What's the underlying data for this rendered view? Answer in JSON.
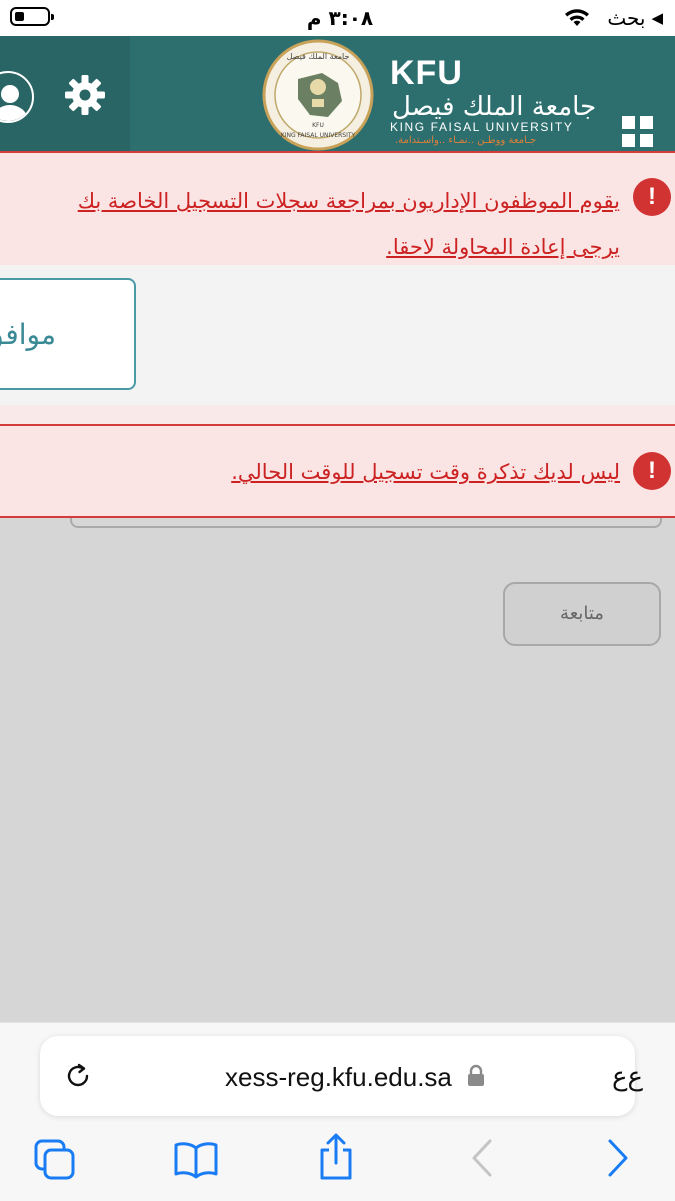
{
  "status_bar": {
    "time": "٣:٠٨ م",
    "carrier": "بحث",
    "back_arrow": "◀"
  },
  "header": {
    "logo_abbr": "KFU",
    "logo_arabic": "جامعة الملك فيصل",
    "logo_english": "KING FAISAL UNIVERSITY",
    "logo_tagline": "جـامعة ووطـن ..نمـاء ..واسـتدامة.",
    "seal_text_top": "جامعة الملك فيصل",
    "seal_text_bottom": "KING FAISAL UNIVERSITY",
    "seal_center": "KFU"
  },
  "alerts": [
    {
      "line1": "يقوم الموظفون الإداريون بمراجعة سجلات التسجيل الخاصة بك",
      "line2": "يرجى إعادة المحاولة لاحقا."
    },
    {
      "line1": "ليس لديك تذكرة وقت تسجيل للوقت الحالي."
    }
  ],
  "alert_icon_glyph": "!",
  "ok_button": {
    "label": "موافق"
  },
  "continue_button": {
    "label": "متابعة"
  },
  "browser": {
    "url": "xess-reg.kfu.edu.sa",
    "text_size_label": "ﻉﻉ"
  },
  "colors": {
    "header_bg": "#2d6f6f",
    "alert_red": "#cc2222",
    "ios_blue": "#1a7cf5"
  }
}
